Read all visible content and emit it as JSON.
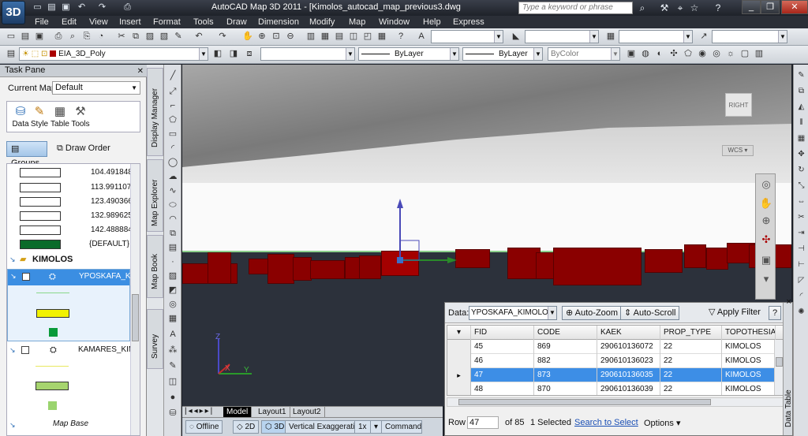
{
  "titlebar": {
    "logo": "3D",
    "title": "AutoCAD Map 3D 2011 - [Kimolos_autocad_map_previous3.dwg",
    "search_placeholder": "Type a keyword or phrase"
  },
  "menu": [
    "File",
    "Edit",
    "View",
    "Insert",
    "Format",
    "Tools",
    "Draw",
    "Dimension",
    "Modify",
    "Map",
    "Window",
    "Help",
    "Express"
  ],
  "properties": {
    "layer_name": "EIA_3D_Poly",
    "linetype": "ByLayer",
    "lineweight": "ByLayer",
    "plotstyle": "ByColor"
  },
  "taskpane": {
    "title": "Task Pane",
    "current_map_label": "Current Map:",
    "current_map_value": "Default",
    "tools": [
      "Data",
      "Style",
      "Table",
      "Tools"
    ],
    "groups_label": "Groups",
    "draworder_label": "Draw Order",
    "legend_values": [
      "104.491848945",
      "113.991107940",
      "123.490366935",
      "132.989625930",
      "142.488884925",
      "{DEFAULT}"
    ],
    "group_name": "KIMOLOS",
    "layer_selected": "YPOSKAFA_KIM",
    "layer_second": "KAMARES_KIM",
    "map_base": "Map Base"
  },
  "sidetabs": [
    "Display Manager",
    "Map Explorer",
    "Map Book",
    "Survey"
  ],
  "viewport": {
    "viewcube_face": "RIGHT",
    "wcs_label": "WCS"
  },
  "layout_tabs": [
    "Model",
    "Layout1",
    "Layout2"
  ],
  "statusbar": {
    "offline": "Offline",
    "mode_2d": "2D",
    "mode_3d": "3D",
    "vertical_exaggeration_label": "Vertical Exaggeration:",
    "vertical_exaggeration_value": "1x",
    "command": "Command"
  },
  "datatable": {
    "data_label": "Data:",
    "data_source": "YPOSKAFA_KIMOLOS_C",
    "auto_zoom": "Auto-Zoom",
    "auto_scroll": "Auto-Scroll",
    "apply_filter": "Apply Filter",
    "help": "?",
    "columns": [
      "FID",
      "CODE",
      "KAEK",
      "PROP_TYPE",
      "TOPOTHESIA"
    ],
    "rows": [
      [
        "45",
        "869",
        "290610136072",
        "22",
        "KIMOLOS"
      ],
      [
        "46",
        "882",
        "290610136023",
        "22",
        "KIMOLOS"
      ],
      [
        "47",
        "873",
        "290610136035",
        "22",
        "KIMOLOS"
      ],
      [
        "48",
        "870",
        "290610136039",
        "22",
        "KIMOLOS"
      ]
    ],
    "selected_row_index": 2,
    "footer_row_label": "Row",
    "footer_row_value": "47",
    "footer_of": "of 85",
    "footer_selected": "1 Selected",
    "footer_search": "Search to Select",
    "footer_options": "Options",
    "side_label": "Data Table"
  }
}
